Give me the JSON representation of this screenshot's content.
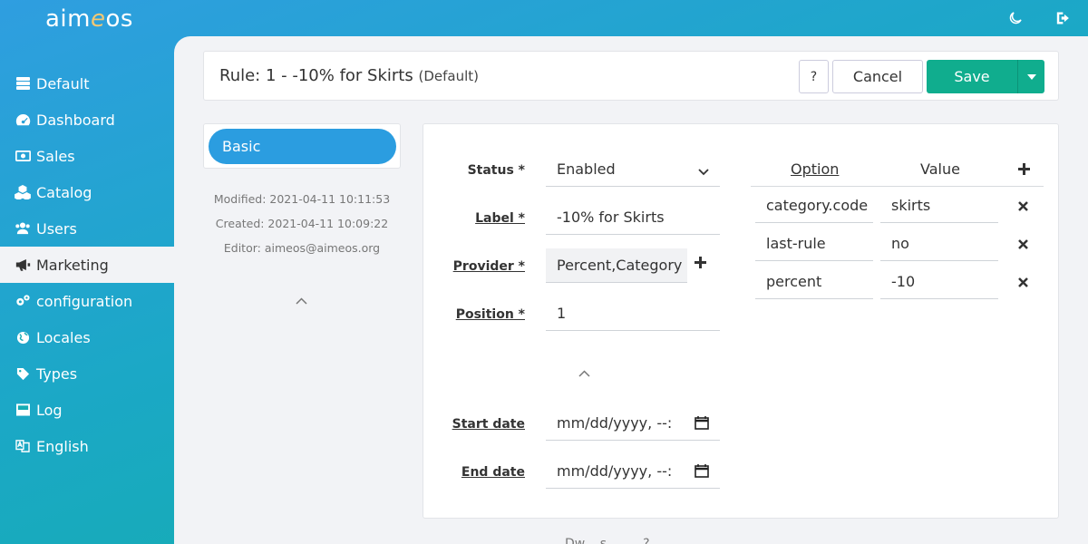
{
  "topbar": {
    "logo_left": "aim",
    "logo_e": "e",
    "logo_right": "os",
    "dark_mode_icon": "moon-icon",
    "logout_icon": "logout-icon"
  },
  "sidebar": {
    "items": [
      {
        "label": "Default",
        "icon": "server-icon"
      },
      {
        "label": "Dashboard",
        "icon": "gauge-icon"
      },
      {
        "label": "Sales",
        "icon": "money-icon"
      },
      {
        "label": "Catalog",
        "icon": "cubes-icon"
      },
      {
        "label": "Users",
        "icon": "users-icon"
      },
      {
        "label": "Marketing",
        "icon": "bullhorn-icon"
      },
      {
        "label": "configuration",
        "icon": "gears-icon"
      },
      {
        "label": "Locales",
        "icon": "globe-icon"
      },
      {
        "label": "Types",
        "icon": "tag-icon"
      },
      {
        "label": "Log",
        "icon": "inbox-icon"
      },
      {
        "label": "English",
        "icon": "language-icon"
      }
    ],
    "active_index": 5
  },
  "header": {
    "title": "Rule: 1 - -10% for Skirts",
    "site": "(Default)",
    "help_label": "?",
    "cancel_label": "Cancel",
    "save_label": "Save"
  },
  "tabs": {
    "basic_label": "Basic"
  },
  "meta": {
    "modified": "Modified: 2021-04-11 10:11:53",
    "created": "Created: 2021-04-11 10:09:22",
    "editor": "Editor: aimeos@aimeos.org"
  },
  "form": {
    "status_label": "Status *",
    "status_value": "Enabled",
    "label_label": "Label *",
    "label_value": "-10% for Skirts",
    "provider_label": "Provider *",
    "provider_value": "Percent,Category",
    "position_label": "Position *",
    "position_value": "1",
    "start_label": "Start date",
    "start_placeholder": "mm/dd/yyyy, --:",
    "end_label": "End date",
    "end_placeholder": "mm/dd/yyyy, --:"
  },
  "config": {
    "option_header": "Option",
    "value_header": "Value",
    "rows": [
      {
        "option": "category.code",
        "value": "skirts"
      },
      {
        "option": "last-rule",
        "value": "no"
      },
      {
        "option": "percent",
        "value": "-10"
      }
    ]
  },
  "footer": {
    "text": "Dw... s ... ... ?"
  },
  "colors": {
    "accent_blue": "#2b9de0",
    "save_green": "#10ad8e"
  }
}
